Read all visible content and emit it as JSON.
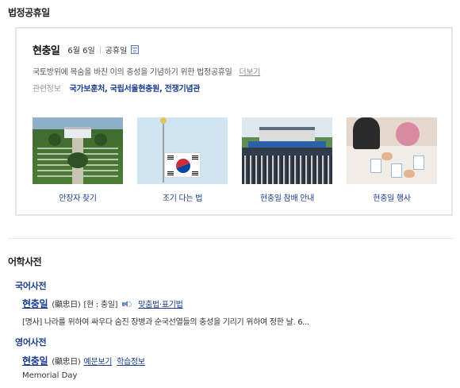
{
  "legal_holiday": {
    "section_title": "법정공휴일",
    "name": "현충일",
    "date": "6월 6일",
    "type": "공휴일",
    "description": "국토방위에 목숨을 바친 이의 충성을 기념하기 위한 법정공휴일",
    "more_link": "더보기",
    "related_label": "관련정보",
    "related_links": "국가보훈처, 국립서울현충원, 전쟁기념관",
    "thumbnails": [
      {
        "caption": "안장자 찾기"
      },
      {
        "caption": "조기 다는 법"
      },
      {
        "caption": "현충일 참배 안내"
      },
      {
        "caption": "현충일 행사"
      }
    ]
  },
  "dictionary": {
    "section_title": "어학사전",
    "korean": {
      "header": "국어사전",
      "word": "현충일",
      "hanja": "(顯忠日)",
      "pronunciation": "[현 : 충일]",
      "spelling_link": "맞춤법·표기법",
      "definition": "[명사] 나라를 위하여 싸우다 숨진 장병과 순국선열들의 충성을 기리기 위하여 정한 날. 6..."
    },
    "english": {
      "header": "영어사전",
      "word": "현충일",
      "hanja": "(顯忠日)",
      "examples_link": "예문보기",
      "study_link": "학습정보",
      "definition": "Memorial Day"
    }
  },
  "colors": {
    "link_blue": "#1a3b8c",
    "border_gray": "#e6e6e6"
  }
}
